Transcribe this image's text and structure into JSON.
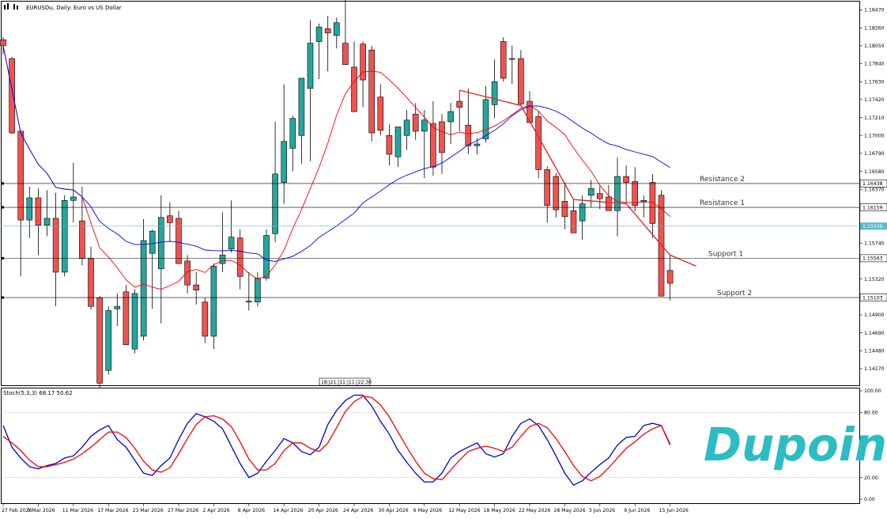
{
  "header": {
    "symbol_title": "EURUSDu, Daily:  Euro vs US Dollar",
    "indicator_title": "Stoch(5,3,3) 68.17 50.62",
    "time_badge": "18:|21:|11:|11:|22:30"
  },
  "watermark": {
    "brand_text": "Dupoin",
    "brand_color": "#2bbdc3"
  },
  "colors": {
    "bull_candle": "#26a69a",
    "bear_candle": "#ef5350",
    "ma_fast": "#ff0000",
    "ma_slow": "#0000ff",
    "stoch_main": "#0000cc",
    "stoch_signal": "#ff0000",
    "zigzag": "#e8262c",
    "bid_line": "#5ab9c9"
  },
  "price_axis": {
    "ticks": [
      "1.18470",
      "1.18260",
      "1.18050",
      "1.17840",
      "1.17630",
      "1.17420",
      "1.17210",
      "1.17000",
      "1.16790",
      "1.16580",
      "1.16370",
      "1.15740",
      "1.15320",
      "1.14900",
      "1.14690",
      "1.14480",
      "1.14270"
    ]
  },
  "stoch_axis": {
    "ticks": [
      "100.00",
      "80.00",
      "20.00",
      "0.00"
    ]
  },
  "date_axis": {
    "labels": [
      "27 Feb 2026",
      "5 Mar 2026",
      "11 Mar 2026",
      "17 Mar 2026",
      "23 Mar 2026",
      "27 Mar 2026",
      "2 Apr 2026",
      "8 Apr 2026",
      "14 Apr 2026",
      "20 Apr 2026",
      "24 Apr 2026",
      "30 Apr 2026",
      "6 May 2026",
      "12 May 2026",
      "18 May 2026",
      "22 May 2026",
      "28 May 2026",
      "3 Jun 2026",
      "9 Jun 2026",
      "15 Jun 2026"
    ]
  },
  "levels": [
    {
      "name": "Resistance 2",
      "tag": "1.16438"
    },
    {
      "name": "Resistance 1",
      "tag": "1.16159"
    },
    {
      "name": "Support 1",
      "tag": "1.15563"
    },
    {
      "name": "Support 2",
      "tag": "1.15103"
    }
  ],
  "bid_price_tag": "1.15939",
  "chart_data": [
    {
      "type": "candlestick",
      "title": "EURUSDu, Daily:  Euro vs US Dollar",
      "x": [
        "2026-02-27",
        "2026-03-02",
        "2026-03-03",
        "2026-03-04",
        "2026-03-05",
        "2026-03-06",
        "2026-03-09",
        "2026-03-10",
        "2026-03-11",
        "2026-03-12",
        "2026-03-13",
        "2026-03-16",
        "2026-03-17",
        "2026-03-18",
        "2026-03-19",
        "2026-03-20",
        "2026-03-23",
        "2026-03-24",
        "2026-03-25",
        "2026-03-26",
        "2026-03-27",
        "2026-03-30",
        "2026-03-31",
        "2026-04-01",
        "2026-04-02",
        "2026-04-03",
        "2026-04-06",
        "2026-04-07",
        "2026-04-08",
        "2026-04-09",
        "2026-04-10",
        "2026-04-13",
        "2026-04-14",
        "2026-04-15",
        "2026-04-16",
        "2026-04-17",
        "2026-04-20",
        "2026-04-21",
        "2026-04-22",
        "2026-04-23",
        "2026-04-24",
        "2026-04-27",
        "2026-04-28",
        "2026-04-29",
        "2026-04-30",
        "2026-05-01",
        "2026-05-04",
        "2026-05-05",
        "2026-05-06",
        "2026-05-07",
        "2026-05-08",
        "2026-05-11",
        "2026-05-12",
        "2026-05-13",
        "2026-05-14",
        "2026-05-15",
        "2026-05-18",
        "2026-05-19",
        "2026-05-20",
        "2026-05-21",
        "2026-05-22",
        "2026-05-25",
        "2026-05-26",
        "2026-05-27",
        "2026-05-28",
        "2026-05-29",
        "2026-06-01",
        "2026-06-02",
        "2026-06-03",
        "2026-06-04",
        "2026-06-05",
        "2026-06-08",
        "2026-06-09",
        "2026-06-10",
        "2026-06-11",
        "2026-06-12",
        "2026-06-15"
      ],
      "ohlc": [
        [
          1.1812,
          1.1815,
          1.1795,
          1.1805
        ],
        [
          1.179,
          1.1792,
          1.1702,
          1.1703
        ],
        [
          1.1705,
          1.1705,
          1.1535,
          1.1601
        ],
        [
          1.1601,
          1.164,
          1.158,
          1.1627
        ],
        [
          1.1627,
          1.1638,
          1.156,
          1.1595
        ],
        [
          1.1595,
          1.1636,
          1.1582,
          1.1603
        ],
        [
          1.1603,
          1.1633,
          1.15,
          1.154
        ],
        [
          1.154,
          1.163,
          1.1535,
          1.1624
        ],
        [
          1.1624,
          1.1668,
          1.1598,
          1.1628
        ],
        [
          1.16,
          1.164,
          1.1548,
          1.1556
        ],
        [
          1.1556,
          1.157,
          1.1496,
          1.15
        ],
        [
          1.151,
          1.1512,
          1.1405,
          1.141
        ],
        [
          1.1425,
          1.15,
          1.142,
          1.1495
        ],
        [
          1.1497,
          1.1515,
          1.1477,
          1.15
        ],
        [
          1.1517,
          1.1525,
          1.1465,
          1.1455
        ],
        [
          1.145,
          1.152,
          1.1445,
          1.1515
        ],
        [
          1.1465,
          1.1602,
          1.146,
          1.1577
        ],
        [
          1.1562,
          1.159,
          1.1497,
          1.1588
        ],
        [
          1.1544,
          1.163,
          1.148,
          1.1604
        ],
        [
          1.1606,
          1.1622,
          1.1575,
          1.1598
        ],
        [
          1.1603,
          1.1612,
          1.157,
          1.155
        ],
        [
          1.1553,
          1.156,
          1.1515,
          1.1525
        ],
        [
          1.1525,
          1.154,
          1.1502,
          1.1519
        ],
        [
          1.1505,
          1.151,
          1.1457,
          1.1465
        ],
        [
          1.1465,
          1.155,
          1.145,
          1.1547
        ],
        [
          1.155,
          1.161,
          1.154,
          1.156
        ],
        [
          1.1567,
          1.1624,
          1.1563,
          1.1581
        ],
        [
          1.158,
          1.159,
          1.152,
          1.1535
        ],
        [
          1.1506,
          1.154,
          1.1495,
          1.1505
        ],
        [
          1.1505,
          1.154,
          1.15,
          1.1533
        ],
        [
          1.1533,
          1.159,
          1.153,
          1.1583
        ],
        [
          1.1585,
          1.1716,
          1.1575,
          1.1655
        ],
        [
          1.1645,
          1.176,
          1.162,
          1.1693
        ],
        [
          1.1685,
          1.1723,
          1.1658,
          1.172
        ],
        [
          1.17,
          1.1745,
          1.1667,
          1.1767
        ],
        [
          1.1755,
          1.1835,
          1.167,
          1.1808
        ],
        [
          1.181,
          1.1831,
          1.1766,
          1.1827
        ],
        [
          1.1825,
          1.184,
          1.1775,
          1.182
        ],
        [
          1.1817,
          1.1838,
          1.1802,
          1.1832
        ],
        [
          1.1808,
          1.1895,
          1.179,
          1.1783
        ],
        [
          1.178,
          1.181,
          1.1727,
          1.1728
        ],
        [
          1.1807,
          1.181,
          1.1733,
          1.1765
        ],
        [
          1.18,
          1.1805,
          1.1693,
          1.1703
        ],
        [
          1.1745,
          1.176,
          1.17,
          1.1706
        ],
        [
          1.17,
          1.1713,
          1.1665,
          1.1678
        ],
        [
          1.1675,
          1.1707,
          1.1663,
          1.171
        ],
        [
          1.17,
          1.173,
          1.1683,
          1.1718
        ],
        [
          1.1725,
          1.1738,
          1.1695,
          1.1705
        ],
        [
          1.1705,
          1.173,
          1.165,
          1.1718
        ],
        [
          1.1714,
          1.174,
          1.1653,
          1.1663
        ],
        [
          1.1716,
          1.1725,
          1.1655,
          1.168
        ],
        [
          1.1716,
          1.1738,
          1.169,
          1.1728
        ],
        [
          1.174,
          1.1753,
          1.1705,
          1.1733
        ],
        [
          1.1712,
          1.1755,
          1.1678,
          1.1688
        ],
        [
          1.1688,
          1.1697,
          1.1678,
          1.169
        ],
        [
          1.1696,
          1.1758,
          1.1692,
          1.1742
        ],
        [
          1.1736,
          1.1789,
          1.172,
          1.1763
        ],
        [
          1.181,
          1.1815,
          1.1763,
          1.1767
        ],
        [
          1.179,
          1.1805,
          1.176,
          1.179
        ],
        [
          1.179,
          1.18,
          1.1735,
          1.1737
        ],
        [
          1.174,
          1.1752,
          1.172,
          1.1715
        ],
        [
          1.1722,
          1.1728,
          1.165,
          1.166
        ],
        [
          1.166,
          1.1664,
          1.1598,
          1.1618
        ],
        [
          1.1652,
          1.1656,
          1.1604,
          1.1613
        ],
        [
          1.1623,
          1.1645,
          1.159,
          1.1605
        ],
        [
          1.1612,
          1.1625,
          1.1586,
          1.1586
        ],
        [
          1.16,
          1.163,
          1.1578,
          1.162
        ],
        [
          1.163,
          1.1648,
          1.1616,
          1.1638
        ],
        [
          1.1632,
          1.1641,
          1.1614,
          1.1626
        ],
        [
          1.1628,
          1.1642,
          1.1618,
          1.1612
        ],
        [
          1.1612,
          1.1674,
          1.1582,
          1.1652
        ],
        [
          1.1652,
          1.1665,
          1.162,
          1.1645
        ],
        [
          1.1646,
          1.1663,
          1.1611,
          1.1618
        ],
        [
          1.1622,
          1.163,
          1.1604,
          1.1624
        ],
        [
          1.1645,
          1.1655,
          1.158,
          1.1597
        ],
        [
          1.163,
          1.1636,
          1.1518,
          1.1512
        ],
        [
          1.1542,
          1.156,
          1.1507,
          1.1527
        ]
      ],
      "moving_averages": [
        {
          "name": "MA fast",
          "color": "#ff0000"
        },
        {
          "name": "MA slow",
          "color": "#0000ff"
        }
      ],
      "horizontal_levels": [
        1.16438,
        1.16159,
        1.15563,
        1.15103
      ],
      "bid": 1.15939,
      "ylim": [
        1.141,
        1.186
      ]
    },
    {
      "type": "line",
      "title": "Stoch(5,3,3) 68.17 50.62",
      "ylim": [
        0,
        100
      ],
      "levels": [
        80,
        20
      ],
      "series": [
        {
          "name": "",
          "color": "#0000cc",
          "values": [
            68,
            48,
            38,
            30,
            28,
            31,
            33,
            38,
            40,
            48,
            58,
            64,
            68,
            55,
            48,
            36,
            24,
            22,
            31,
            38,
            55,
            70,
            79,
            76,
            72,
            65,
            49,
            33,
            20,
            24,
            35,
            45,
            56,
            52,
            44,
            41,
            48,
            69,
            82,
            91,
            96,
            96,
            86,
            72,
            60,
            45,
            34,
            24,
            16,
            16,
            24,
            38,
            44,
            48,
            52,
            42,
            39,
            42,
            58,
            70,
            74,
            68,
            55,
            40,
            24,
            13,
            17,
            25,
            32,
            38,
            50,
            57,
            58,
            68,
            70,
            68,
            50
          ]
        },
        {
          "name": "",
          "color": "#ff0000",
          "values": [
            58,
            52,
            45,
            36,
            30,
            30,
            32,
            34,
            37,
            42,
            48,
            55,
            62,
            62,
            57,
            47,
            35,
            27,
            25,
            29,
            42,
            56,
            69,
            76,
            77,
            74,
            67,
            53,
            37,
            27,
            27,
            33,
            45,
            52,
            52,
            47,
            44,
            52,
            66,
            81,
            90,
            95,
            94,
            87,
            76,
            62,
            48,
            35,
            24,
            19,
            18,
            27,
            36,
            44,
            47,
            49,
            47,
            44,
            48,
            58,
            67,
            70,
            66,
            56,
            44,
            31,
            21,
            17,
            21,
            29,
            38,
            47,
            53,
            60,
            65,
            68,
            51
          ]
        }
      ]
    }
  ]
}
